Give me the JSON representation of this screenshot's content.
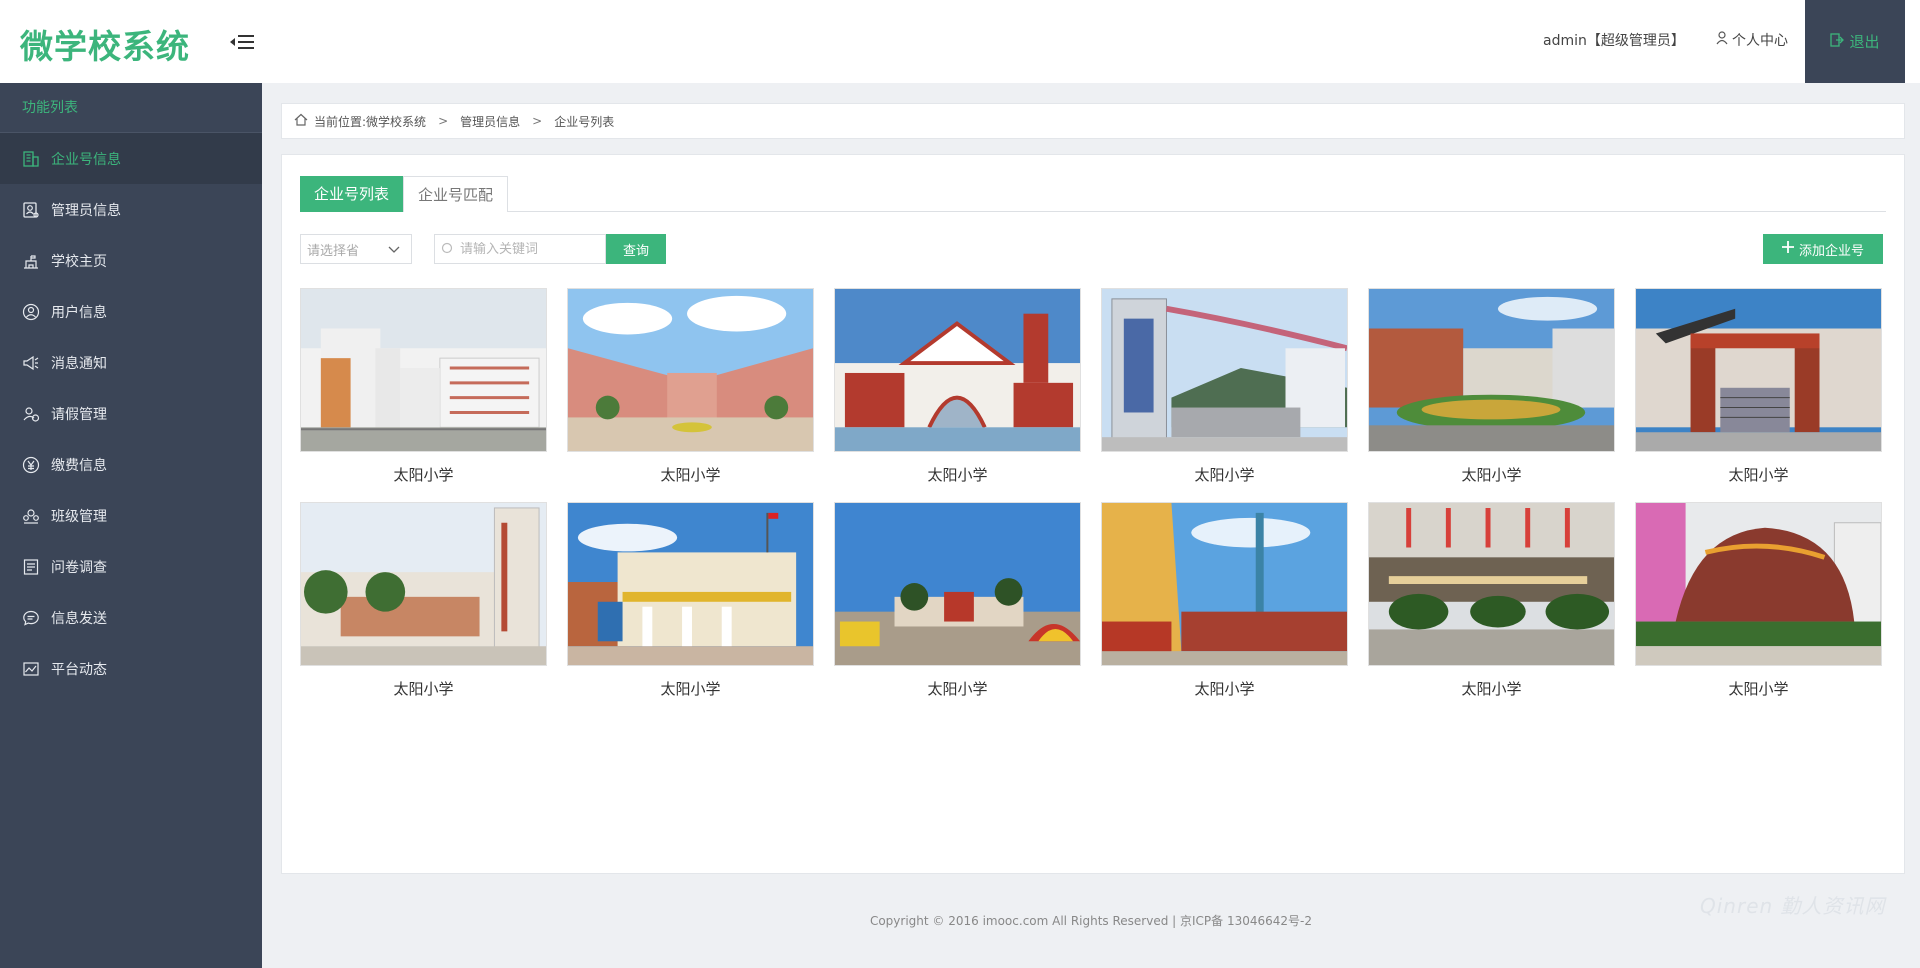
{
  "header": {
    "logo": "微学校系统",
    "user": "admin【超级管理员】",
    "profile": "个人中心",
    "logout": "退出"
  },
  "sidebar": {
    "title": "功能列表",
    "items": [
      {
        "label": "企业号信息",
        "icon": "building-icon",
        "active": true
      },
      {
        "label": "管理员信息",
        "icon": "admin-card-icon"
      },
      {
        "label": "学校主页",
        "icon": "school-icon"
      },
      {
        "label": "用户信息",
        "icon": "user-icon"
      },
      {
        "label": "消息通知",
        "icon": "megaphone-icon"
      },
      {
        "label": "请假管理",
        "icon": "leave-icon"
      },
      {
        "label": "缴费信息",
        "icon": "payment-icon"
      },
      {
        "label": "班级管理",
        "icon": "class-icon"
      },
      {
        "label": "问卷调查",
        "icon": "survey-icon"
      },
      {
        "label": "信息发送",
        "icon": "chat-icon"
      },
      {
        "label": "平台动态",
        "icon": "chart-icon"
      }
    ]
  },
  "breadcrumb": {
    "prefix": "当前位置:",
    "items": [
      "微学校系统",
      "管理员信息",
      "企业号列表"
    ],
    "separator": ">"
  },
  "tabs": [
    "企业号列表",
    "企业号匹配"
  ],
  "filters": {
    "select_placeholder": "请选择省",
    "search_placeholder": "请输入关键词",
    "query_label": "查询",
    "add_label": "添加企业号"
  },
  "schools": [
    "太阳小学",
    "太阳小学",
    "太阳小学",
    "太阳小学",
    "太阳小学",
    "太阳小学",
    "太阳小学",
    "太阳小学",
    "太阳小学",
    "太阳小学",
    "太阳小学",
    "太阳小学"
  ],
  "footer": "Copyright © 2016 imooc.com All Rights Reserved | 京ICP备 13046642号-2",
  "watermark": "Qinren 勤人资讯网",
  "colors": {
    "accent": "#3cb57c",
    "sidebar": "#3b4557",
    "sidebar_active": "#323b4a"
  }
}
